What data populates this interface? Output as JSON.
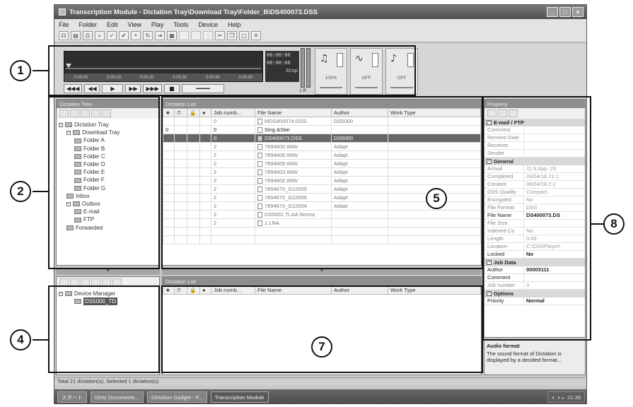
{
  "window": {
    "title": "Transcription Module - Dictation Tray\\Download Tray\\Folder_B\\DS400073.DSS",
    "buttons": [
      "_",
      "□",
      "×"
    ]
  },
  "menu": [
    "File",
    "Folder",
    "Edit",
    "View",
    "Play",
    "Tools",
    "Device",
    "Help"
  ],
  "toolbar_icons": [
    "headset-icon",
    "save-icon",
    "print-icon",
    "find-icon",
    "check-icon",
    "check-icon",
    "dot-icon",
    "refresh-icon",
    "forward-icon",
    "settings-icon",
    "dim-icon",
    "dim-icon",
    "separator-icon",
    "cut-icon",
    "copy-icon",
    "paste-icon",
    "delete-icon"
  ],
  "player": {
    "time_display": [
      "00:00:00",
      "00:00:00"
    ],
    "mode": "Stop",
    "ruler_ticks": [
      "0:00:00",
      "0:00:10",
      "0:00:20",
      "0:00:30",
      "0:00:40",
      "0:00:50"
    ],
    "controls": [
      "◀◀◀",
      "◀◀",
      "▶",
      "▶▶",
      "▶▶▶",
      "■"
    ],
    "knobs": [
      {
        "glyph": "🔔",
        "label": "100%"
      },
      {
        "glyph": "〰",
        "label": "OFF"
      },
      {
        "glyph": "♪",
        "label": "OFF"
      }
    ],
    "meter_label": "L  R"
  },
  "dictation_tree": {
    "title": "Dictation Tree",
    "items": [
      {
        "label": "Dictation Tray",
        "depth": 0,
        "icon": "tray-icon"
      },
      {
        "label": "Download Tray",
        "depth": 1,
        "icon": "folder-icon"
      },
      {
        "label": "Folder A",
        "depth": 2,
        "icon": "folder-icon"
      },
      {
        "label": "Folder B",
        "depth": 2,
        "icon": "folder-icon"
      },
      {
        "label": "Folder C",
        "depth": 2,
        "icon": "folder-icon"
      },
      {
        "label": "Folder D",
        "depth": 2,
        "icon": "folder-icon"
      },
      {
        "label": "Folder E",
        "depth": 2,
        "icon": "folder-icon"
      },
      {
        "label": "Folder F",
        "depth": 2,
        "icon": "folder-icon"
      },
      {
        "label": "Folder G",
        "depth": 2,
        "icon": "folder-icon"
      },
      {
        "label": "Inbox",
        "depth": 1,
        "icon": "inbox-icon"
      },
      {
        "label": "Outbox",
        "depth": 1,
        "icon": "outbox-icon"
      },
      {
        "label": "E-mail",
        "depth": 2,
        "icon": "email-icon"
      },
      {
        "label": "FTP",
        "depth": 2,
        "icon": "ftp-icon"
      },
      {
        "label": "Forwarded",
        "depth": 1,
        "icon": "forwarded-icon"
      }
    ]
  },
  "dictation_list": {
    "title": "Dictation List",
    "columns": [
      "★",
      "⏱",
      "🔒",
      "●",
      "Job numb...",
      "File Name",
      "Author",
      "Work Type"
    ],
    "rows": [
      {
        "job": "0",
        "file": "MDS400074.DSS",
        "author": "DS5000",
        "work": "",
        "style": "dim"
      },
      {
        "job": "0",
        "file": "Sing &Star",
        "author": "",
        "work": "",
        "style": "bold",
        "prefix": "0"
      },
      {
        "job": "0",
        "file": "DS400073.DSS",
        "author": "DS5000",
        "work": "",
        "style": "sel"
      },
      {
        "job": "2",
        "file": "7894600.WAV",
        "author": "Adapt",
        "work": "",
        "style": "dim"
      },
      {
        "job": "2",
        "file": "7894608.WAV",
        "author": "Adapt",
        "work": "",
        "style": "dim"
      },
      {
        "job": "2",
        "file": "7894609.WAV",
        "author": "Adapt",
        "work": "",
        "style": "dim"
      },
      {
        "job": "2",
        "file": "7894603.WAV",
        "author": "Adapt",
        "work": "",
        "style": "dim"
      },
      {
        "job": "2",
        "file": "7894602.WAV",
        "author": "Adapt",
        "work": "",
        "style": "dim"
      },
      {
        "job": "2",
        "file": "7894670_G22005",
        "author": "Adapt",
        "work": "",
        "style": "dim"
      },
      {
        "job": "2",
        "file": "7894670_G22006",
        "author": "Adapt",
        "work": "",
        "style": "dim"
      },
      {
        "job": "2",
        "file": "7894670_G22004",
        "author": "Adapt",
        "work": "",
        "style": "dim"
      },
      {
        "job": "2",
        "file": "DS5001 TLAA Norms",
        "author": "",
        "work": "",
        "style": "dim"
      },
      {
        "job": "2",
        "file": "1.LNA",
        "author": "",
        "work": "",
        "style": "dim"
      }
    ]
  },
  "device_tree": {
    "items": [
      {
        "label": "Device Manager",
        "depth": 0
      },
      {
        "label": "DS5000_TD",
        "depth": 1
      }
    ]
  },
  "device_list": {
    "title": "Dictation List",
    "columns": [
      "★",
      "⏱",
      "🔒",
      "●",
      "Job numb...",
      "File Name",
      "Author",
      "Work Type"
    ]
  },
  "properties": {
    "title": "Property",
    "sort_icons": [
      "categorize-icon",
      "alpha-sort-icon",
      "pages-icon"
    ],
    "groups": [
      {
        "name": "E-mail / FTP",
        "rows": [
          {
            "k": "Comment",
            "v": ""
          },
          {
            "k": "Receive Date",
            "v": ""
          },
          {
            "k": "Receiver",
            "v": ""
          },
          {
            "k": "Sender",
            "v": ""
          }
        ]
      },
      {
        "name": "General",
        "rows": [
          {
            "k": "Arrival",
            "v": "11.9.App. 23"
          },
          {
            "k": "Completed",
            "v": "24/04/18 21:1"
          },
          {
            "k": "Created",
            "v": "08/04/18 2:2"
          },
          {
            "k": "DSS Quality",
            "v": "Compact"
          },
          {
            "k": "Encrypted",
            "v": "No"
          },
          {
            "k": "File Format",
            "v": "DSS"
          },
          {
            "k": "File Name",
            "v": "DS400073.DS",
            "strong": true
          },
          {
            "k": "File Size",
            "v": ""
          },
          {
            "k": "Indexed Co",
            "v": "No"
          },
          {
            "k": "Length",
            "v": "0:00"
          },
          {
            "k": "Location",
            "v": "C:\\DSSPlayer\\"
          },
          {
            "k": "Locked",
            "v": "No",
            "strong": true
          }
        ]
      },
      {
        "name": "Job Data",
        "rows": [
          {
            "k": "Author",
            "v": "00003111",
            "strong": true
          },
          {
            "k": "Comment",
            "v": "",
            "strong": true
          },
          {
            "k": "Job number",
            "v": "0"
          }
        ]
      },
      {
        "name": "Options",
        "rows": [
          {
            "k": "Priority",
            "v": "Normal",
            "strong": true
          }
        ]
      }
    ],
    "description_title": "Audio format",
    "description_text": "The sound format of Dictation is displayed by a decided format..."
  },
  "statusbar": "Total 21 dictation(s), Selected 1 dictation(s)",
  "taskbar": {
    "start": "スタート",
    "tasks": [
      "Dicty Documents...",
      "Dictation Gadget - P...",
      "Transcription Module"
    ],
    "clock": "21:38"
  },
  "callouts": [
    "1",
    "2",
    "4",
    "5",
    "7",
    "8"
  ]
}
